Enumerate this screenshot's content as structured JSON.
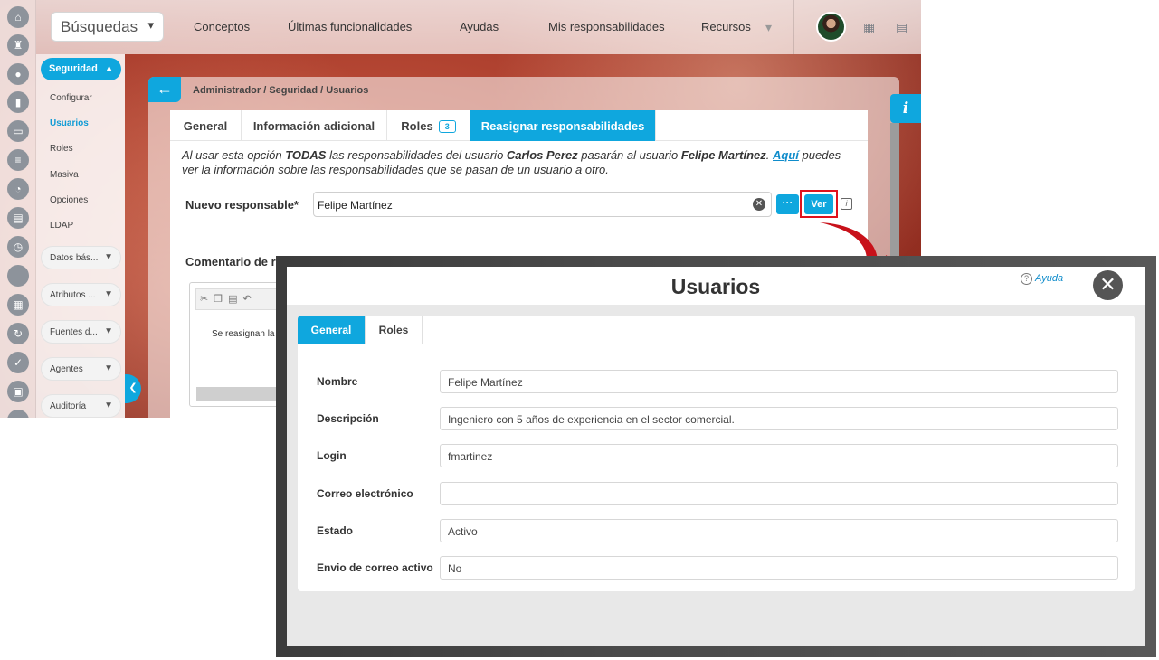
{
  "background_app": {
    "search": {
      "placeholder": "Búsquedas",
      "chevron": "▾"
    },
    "top_links": [
      "Conceptos",
      "Últimas funcionalidades",
      "Ayudas",
      "Mis responsabilidades",
      "Recursos"
    ],
    "side_menu": {
      "active_group": "Seguridad",
      "items": [
        {
          "label": "Configurar",
          "active": false
        },
        {
          "label": "Usuarios",
          "active": true
        },
        {
          "label": "Roles",
          "active": false
        },
        {
          "label": "Masiva",
          "active": false
        },
        {
          "label": "Opciones",
          "active": false
        },
        {
          "label": "LDAP",
          "active": false
        }
      ],
      "groups": [
        "Datos bás...",
        "Atributos ...",
        "Fuentes d...",
        "Agentes",
        "Auditoría"
      ]
    },
    "breadcrumb": "Administrador / Seguridad / Usuarios",
    "info_tab": "i",
    "tabs": [
      {
        "label": "General"
      },
      {
        "label": "Información adicional"
      },
      {
        "label": "Roles",
        "badge": "3"
      },
      {
        "label": "Reasignar responsabilidades",
        "active": true
      }
    ],
    "note": {
      "p1": "Al usar esta opción ",
      "b1": "TODAS",
      "p2": " las responsabilidades del usuario ",
      "b2": "Carlos Perez",
      "p3": " pasarán al usuario ",
      "b3": "Felipe Martínez",
      "p4": ". ",
      "link": "Aquí",
      "p5": " puedes ver la información sobre las responsabilidades que se pasan de un usuario a otro."
    },
    "new_responsible_label": "Nuevo responsable*",
    "new_responsible_value": "Felipe Martínez",
    "more_button": "···",
    "ver_button": "Ver",
    "comment_label": "Comentario de re",
    "editor_text": "Se reasignan la",
    "highlight_color": "#e0121d",
    "accent_color": "#0fa7de"
  },
  "modal": {
    "title": "Usuarios",
    "help": "Ayuda",
    "close": "✕",
    "tabs": [
      {
        "label": "General",
        "active": true
      },
      {
        "label": "Roles",
        "active": false
      }
    ],
    "fields": [
      {
        "label": "Nombre",
        "value": "Felipe Martínez"
      },
      {
        "label": "Descripción",
        "value": "Ingeniero con 5 años de experiencia en el sector comercial."
      },
      {
        "label": "Login",
        "value": "fmartinez"
      },
      {
        "label": "Correo electrónico",
        "value": ""
      },
      {
        "label": "Estado",
        "value": "Activo"
      },
      {
        "label": "Envio de correo activo",
        "value": "No"
      }
    ]
  }
}
